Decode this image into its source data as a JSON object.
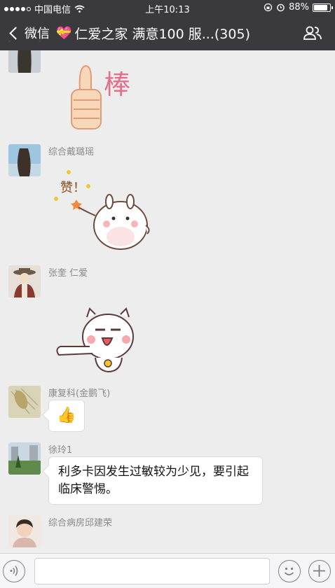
{
  "status": {
    "carrier": "中国电信",
    "time": "上午10:13",
    "battery": "88%",
    "battery_level": 0.88
  },
  "nav": {
    "back_label": "微信",
    "title": "仁爱之家  满意100  服...(305)"
  },
  "messages": [
    {
      "sender": "",
      "type": "sticker",
      "sticker": "thumbs-up-sticker",
      "sticker_text": "棒"
    },
    {
      "sender": "综合戴璐瑶",
      "type": "sticker",
      "sticker": "hamster-praise-sticker",
      "sticker_text": "赞！"
    },
    {
      "sender": "张奎 仁爱",
      "type": "sticker",
      "sticker": "cat-pointing-sticker"
    },
    {
      "sender": "康复科(金鹏飞)",
      "type": "emoji",
      "emoji": "👍"
    },
    {
      "sender": "徐玲1",
      "type": "text",
      "text": "利多卡因发生过敏较为少见，要引起临床警惕。"
    },
    {
      "sender": "综合病房邱建荣",
      "type": "partial"
    }
  ],
  "colors": {
    "nav_bg": "#3a3a3e",
    "chat_bg": "#ededed",
    "name_gray": "#8a8a8a"
  }
}
